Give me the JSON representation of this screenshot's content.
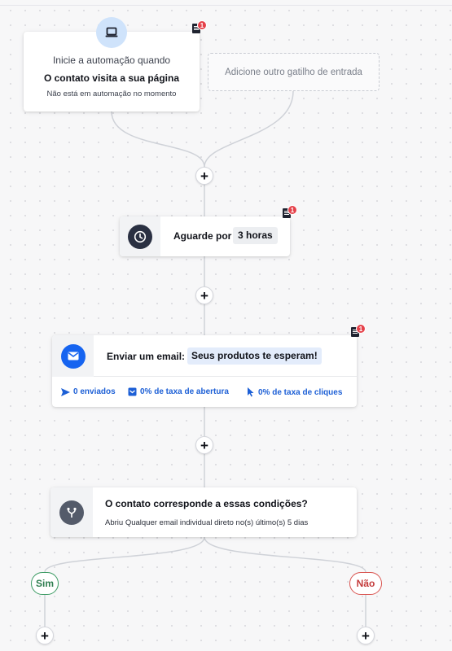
{
  "trigger": {
    "line1": "Inicie a automação quando",
    "line2": "O contato visita a sua página",
    "line3": "Não está em automação no momento",
    "icon": "laptop-icon",
    "badge_count": "1"
  },
  "add_trigger": {
    "label": "Adicione outro gatilho de entrada"
  },
  "wait_step": {
    "label": "Aguarde por",
    "value": "3 horas",
    "icon": "clock-icon",
    "badge_count": "1"
  },
  "email_step": {
    "label": "Enviar um email:",
    "subject": "Seus produtos te esperam!",
    "icon": "envelope-icon",
    "badge_count": "1",
    "stats": {
      "sent": "0 enviados",
      "open_rate": "0% de taxa de abertura",
      "click_rate": "0% de taxa de cliques"
    }
  },
  "condition_step": {
    "title": "O contato corresponde a essas condições?",
    "description": "Abriu Qualquer email individual direto no(s) último(s) 5 dias",
    "icon": "branch-icon"
  },
  "branches": {
    "yes": "Sim",
    "no": "Não"
  },
  "plus_label": "+",
  "colors": {
    "accent_blue": "#1664f0",
    "badge_red": "#e5414a",
    "yes_green": "#3a9a62",
    "no_red": "#d9534f"
  }
}
